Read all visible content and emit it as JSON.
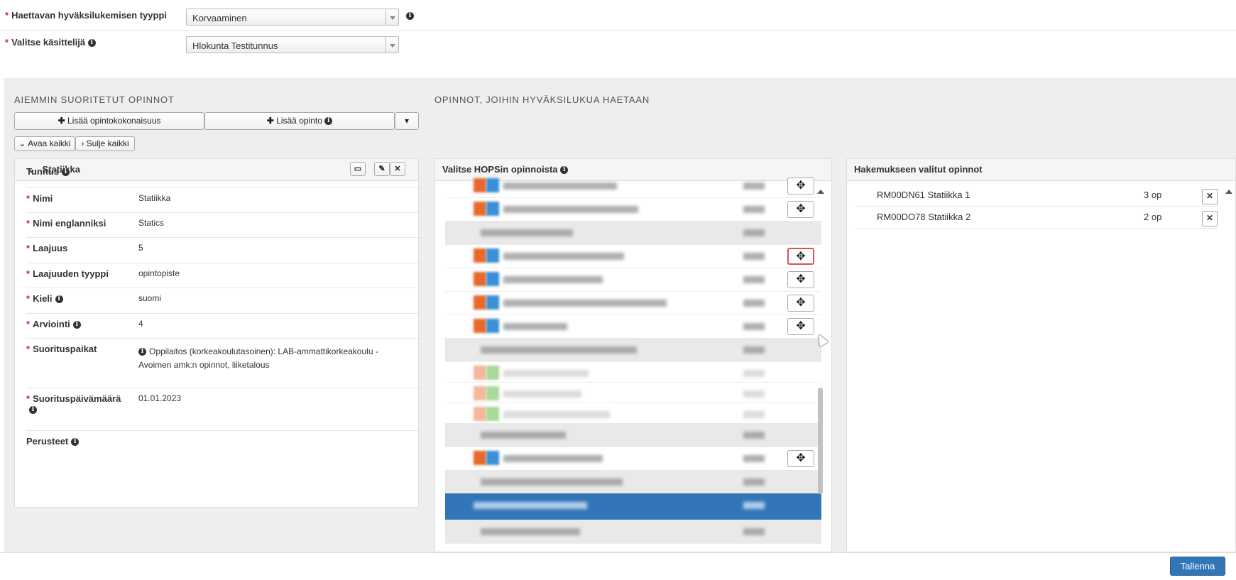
{
  "form": {
    "type_label": "Haettavan hyväksilukemisen tyyppi",
    "type_value": "Korvaaminen",
    "handler_label": "Valitse käsittelijä",
    "handler_value": "Hlokunta Testitunnus"
  },
  "left": {
    "header": "AIEMMIN SUORITETUT OPINNOT",
    "add_entity_label": "Lisää opintokokonaisuus",
    "add_course_label": "Lisää opinto",
    "expand_all_label": "Avaa kaikki",
    "collapse_all_label": "Sulje kaikki",
    "panel_title": "Statiikka",
    "fields": [
      {
        "label": "Tunnus",
        "value": "",
        "required": false,
        "info": true
      },
      {
        "label": "Nimi",
        "value": "Statiikka",
        "required": true,
        "info": false
      },
      {
        "label": "Nimi englanniksi",
        "value": "Statics",
        "required": true,
        "info": false
      },
      {
        "label": "Laajuus",
        "value": "5",
        "required": true,
        "info": false
      },
      {
        "label": "Laajuuden tyyppi",
        "value": "opintopiste",
        "required": true,
        "info": false
      },
      {
        "label": "Kieli",
        "value": "suomi",
        "required": true,
        "info": true
      },
      {
        "label": "Arviointi",
        "value": "4",
        "required": true,
        "info": true
      },
      {
        "label": "Suorituspaikat",
        "value": "Oppilaitos (korkeakoulutasoinen): LAB-ammattikorkeakoulu - Avoimen amk:n opinnot, liiketalous",
        "required": true,
        "info": false
      },
      {
        "label": "Suorituspäivämäärä",
        "value": "01.01.2023",
        "required": true,
        "info": true
      },
      {
        "label": "Perusteet",
        "value": "",
        "required": false,
        "info": true
      }
    ]
  },
  "middle": {
    "header": "OPINNOT, JOIHIN HYVÄKSILUKUA HAETAAN",
    "panel_title": "Valitse HOPSin opinnoista"
  },
  "right": {
    "panel_title": "Hakemukseen valitut opinnot",
    "items": [
      {
        "code_name": "RM00DN61 Statiikka 1",
        "credits": "3 op"
      },
      {
        "code_name": "RM00DO78 Statiikka 2",
        "credits": "2 op"
      }
    ]
  },
  "footer": {
    "save_label": "Tallenna"
  },
  "colors": {
    "primary": "#3276b8",
    "highlight": "#d9534f"
  }
}
